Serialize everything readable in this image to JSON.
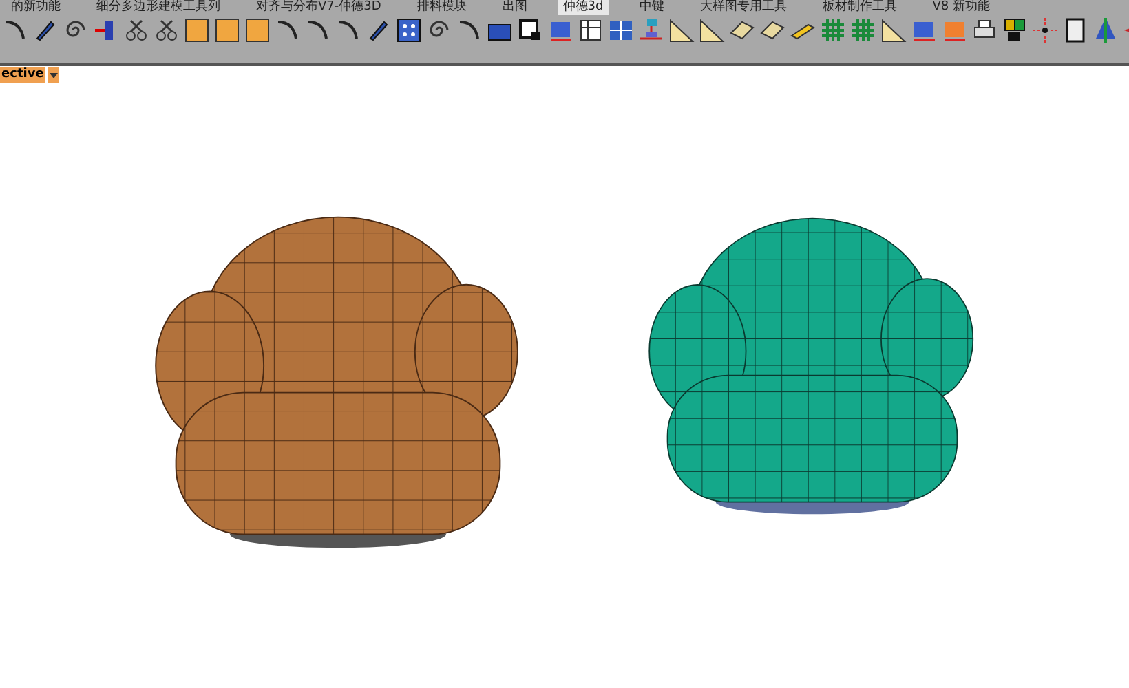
{
  "toolbar_tabs": [
    {
      "label": "的新功能",
      "selected": false
    },
    {
      "label": "细分多边形建模工具列",
      "selected": false
    },
    {
      "label": "对齐与分布V7-仲德3D",
      "selected": false
    },
    {
      "label": "排料模块",
      "selected": false
    },
    {
      "label": "出图",
      "selected": false
    },
    {
      "label": "仲德3d",
      "selected": true
    },
    {
      "label": "中键",
      "selected": false
    },
    {
      "label": "大样图专用工具",
      "selected": false
    },
    {
      "label": "板材制作工具",
      "selected": false
    },
    {
      "label": "V8 新功能",
      "selected": false
    }
  ],
  "viewport": {
    "label": "ective"
  }
}
